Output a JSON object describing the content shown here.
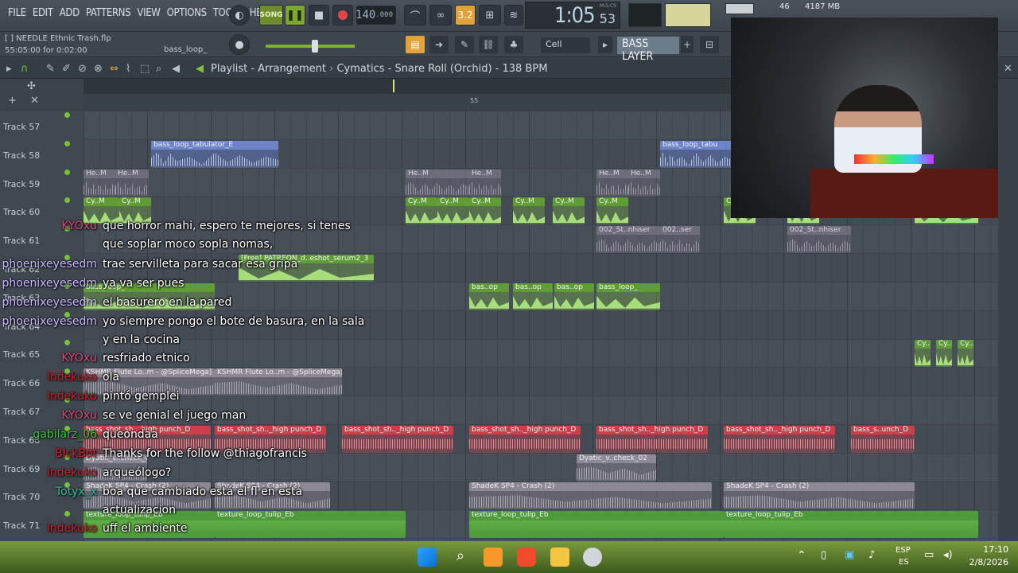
{
  "menu": [
    "FILE",
    "EDIT",
    "ADD",
    "PATTERNS",
    "VIEW",
    "OPTIONS",
    "TOOLS",
    "HELP"
  ],
  "transport": {
    "song_label": "SONG",
    "tempo": "140",
    "tempo_decimals": ".000",
    "pattern_number": "3.2"
  },
  "time": {
    "main": "1:05",
    "secs": "53",
    "label": "M:S:CS"
  },
  "system": {
    "cpu": "46",
    "memory": "4187 MB"
  },
  "project": {
    "name": "[ ] NEEDLE Ethnic Trash.flp",
    "hint": "55:05:00 for 0:02:00",
    "channel": "bass_loop_"
  },
  "snap": "Cell",
  "channel_layer": "BASS LAYER",
  "playlist": {
    "title": "Playlist - Arrangement",
    "pattern": "Cymatics - Snare Roll (Orchid) - 138 BPM",
    "ruler_marker": "55"
  },
  "tracks": [
    "Track 57",
    "Track 58",
    "Track 59",
    "Track 60",
    "Track 61",
    "Track 62",
    "Track 63",
    "Track 64",
    "Track 65",
    "Track 66",
    "Track 67",
    "Track 68",
    "Track 69",
    "Track 70",
    "Track 71"
  ],
  "clips": {
    "bass_loop_tabulator": "bass_loop_tabulator_E",
    "bass_loop_tabu_short": "bass_loop_tabu",
    "he_m": "He..M",
    "cy_m": "Cy..M",
    "st_nhiser": "002_St..nhiser",
    "st_ser": "002..ser",
    "patreon": "[Free] PATREON_d..eshot_serum2_3",
    "bas_op": "bas..op",
    "bass_loop_short": "bass_loop_",
    "flute": "KSHMR Flute Lo..m - @SpliceMega]",
    "bass_shot": "bass_shot_sh.._high punch_D",
    "bass_s_unch": "bass_s..unch_D",
    "dyatic": "Dyatic_v..check_02",
    "crash": "ShadeK SP4 - Crash (2)",
    "texture": "texture_loop_tulip_Eb"
  },
  "chat": [
    {
      "user": "KYOxu",
      "color": "#e0457b",
      "lines": [
        "que horror mahi, espero te mejores, si tenes",
        "que soplar moco sopla nomas,"
      ]
    },
    {
      "user": "phoenixeyesedm",
      "color": "#c9b8ff",
      "lines": [
        "trae servilleta para sacar esa gripa"
      ]
    },
    {
      "user": "phoenixeyesedm",
      "color": "#c9b8ff",
      "lines": [
        "ya va ser pues"
      ]
    },
    {
      "user": "phoenixeyesedm",
      "color": "#c9b8ff",
      "lines": [
        "el basurero en la pared"
      ]
    },
    {
      "user": "phoenixeyesedm",
      "color": "#c9b8ff",
      "lines": [
        "yo siempre pongo el bote de basura, en la sala",
        "y en la cocina"
      ]
    },
    {
      "user": "KYOxu",
      "color": "#e0457b",
      "lines": [
        "resfriado etnico"
      ]
    },
    {
      "user": "indekuko",
      "color": "#d21f2a",
      "lines": [
        "ola"
      ]
    },
    {
      "user": "indekuko",
      "color": "#d21f2a",
      "lines": [
        "pintó gemplei"
      ]
    },
    {
      "user": "KYOxu",
      "color": "#e0457b",
      "lines": [
        "se ve genial el juego man"
      ]
    },
    {
      "user": "gabilarz_06",
      "color": "#3fbf3f",
      "lines": [
        "queondaa"
      ]
    },
    {
      "user": "BlckBot",
      "color": "#d21f2a",
      "lines": [
        "Thanks for the follow @thiagofrancis"
      ]
    },
    {
      "user": "indekuko",
      "color": "#d21f2a",
      "lines": [
        "arqueólogo?"
      ]
    },
    {
      "user": "Totyx_x",
      "color": "#2fc3a0",
      "lines": [
        "boa que cambiado está el fl en esta",
        "actualizacion"
      ]
    },
    {
      "user": "indekuko",
      "color": "#d21f2a",
      "lines": [
        "uff el ambiente"
      ]
    }
  ],
  "taskbar": {
    "lang_top": "ESP",
    "lang_bottom": "ES",
    "time": "17:10",
    "date": "2/8/2026"
  }
}
